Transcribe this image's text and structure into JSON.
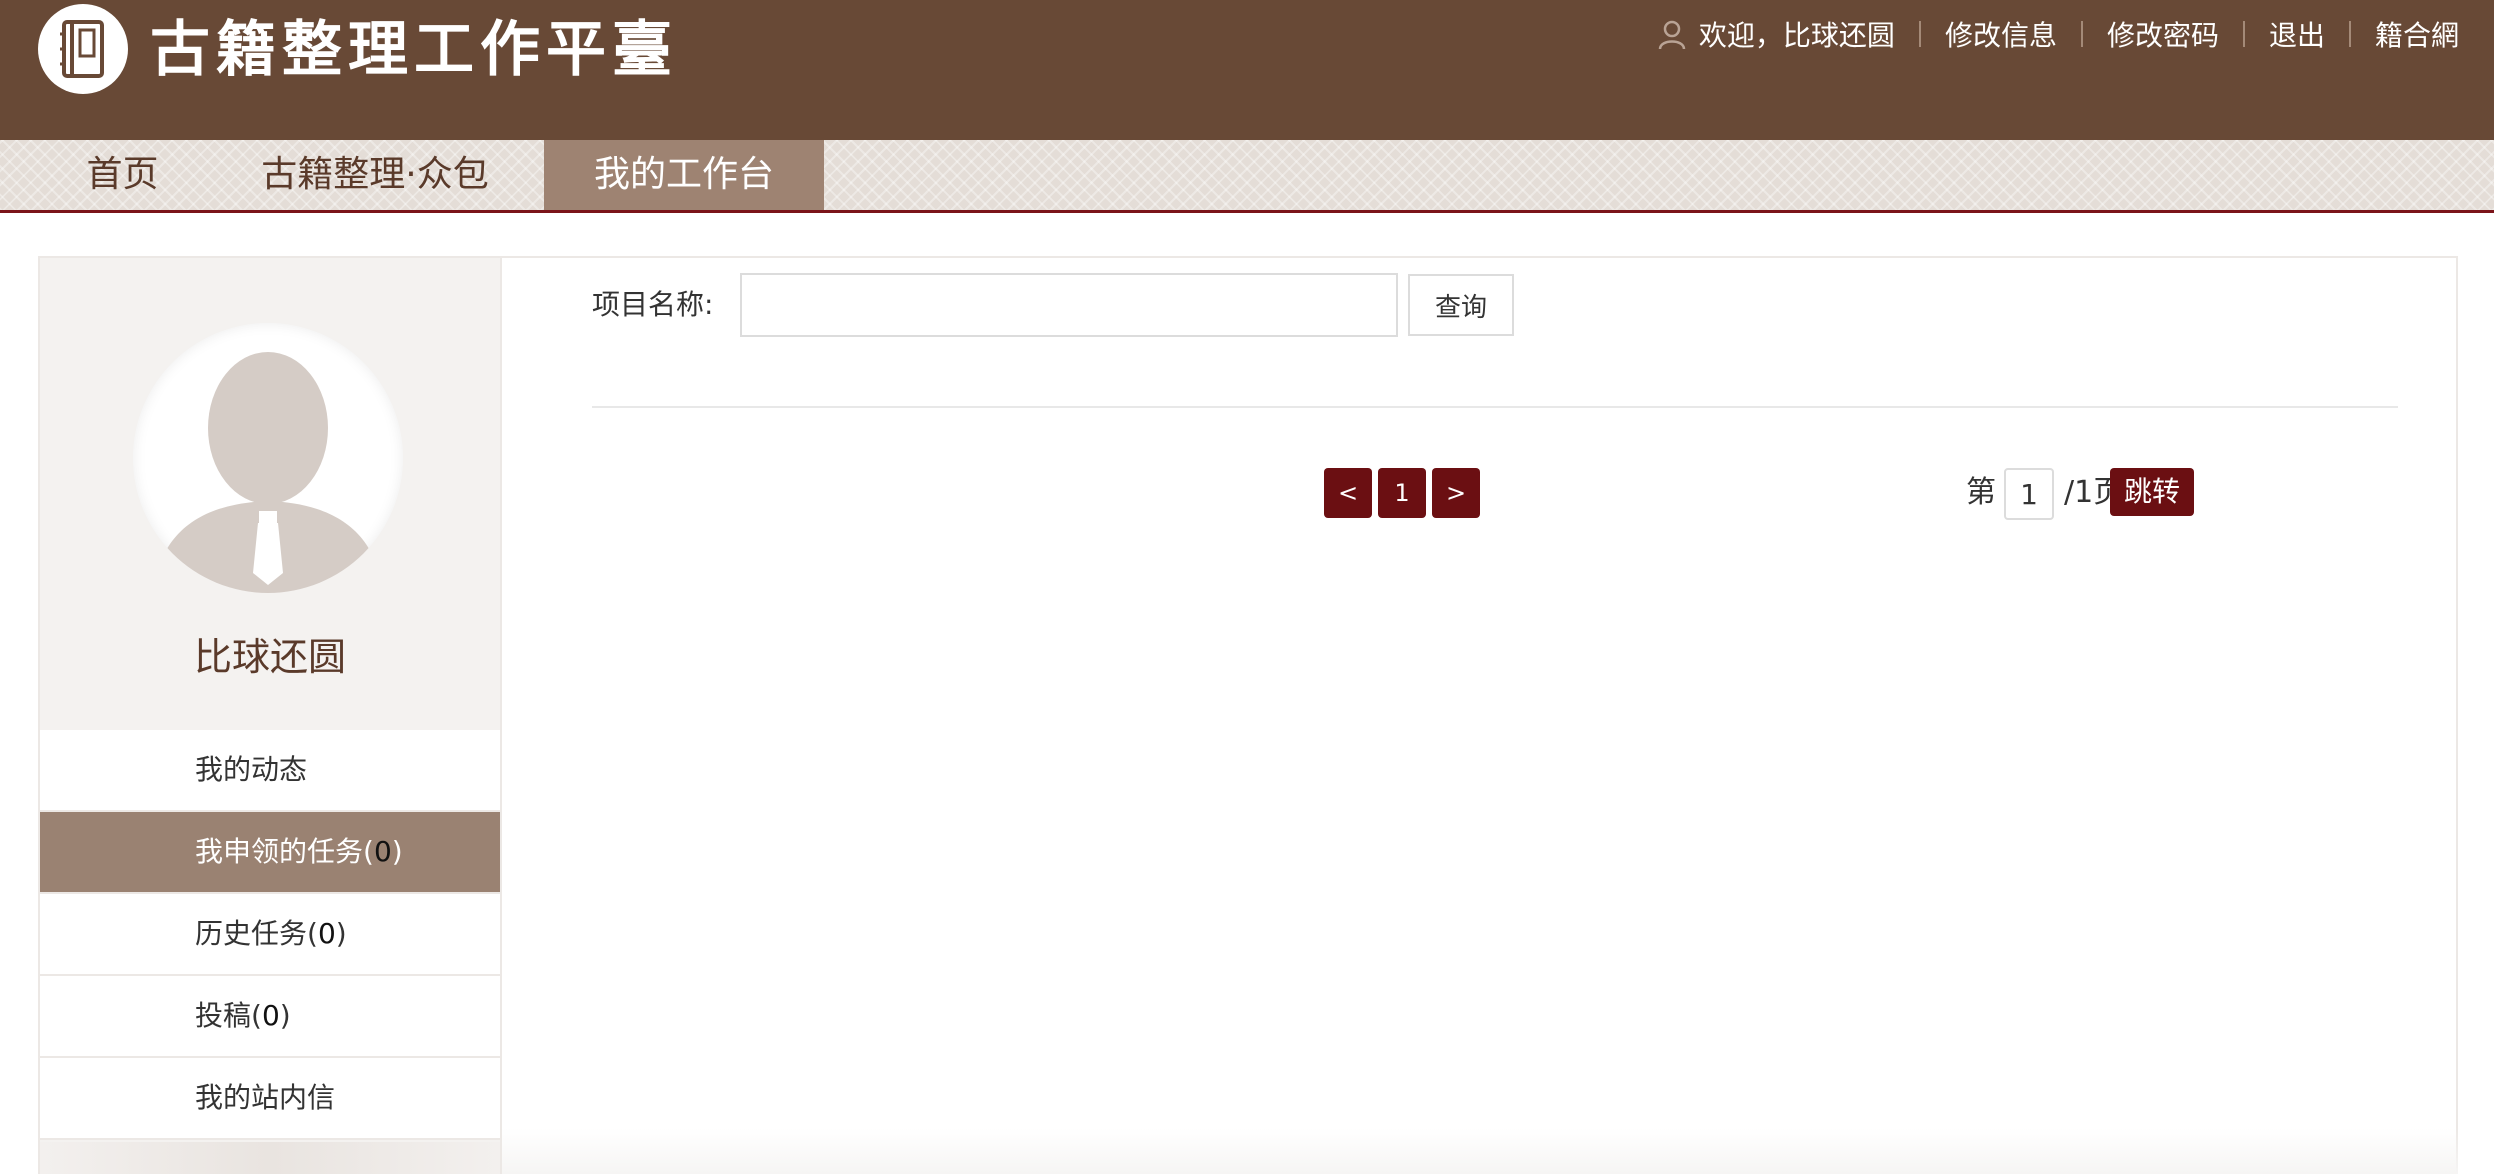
{
  "header": {
    "site_title": "古籍整理工作平臺",
    "logo_icon": "book-icon",
    "user_icon": "user-icon",
    "welcome": "欢迎，比球还圆",
    "links": [
      "修改信息",
      "修改密码",
      "退出",
      "籍合網"
    ]
  },
  "nav": {
    "items": [
      "首页",
      "古籍整理·众包",
      "我的工作台"
    ],
    "active": "我的工作台"
  },
  "sidebar": {
    "avatar_icon": "avatar-silhouette-icon",
    "user_name": "比球还圆",
    "menu": [
      {
        "label": "我的动态",
        "count": ""
      },
      {
        "label": "我申领的任务",
        "count": "0"
      },
      {
        "label": "历史任务",
        "count": "0"
      },
      {
        "label": "投稿",
        "count": "0"
      },
      {
        "label": "我的站内信",
        "count": ""
      }
    ],
    "active_item": "我申领的任务"
  },
  "search": {
    "label": "项目名称:",
    "value": "",
    "button": "查询"
  },
  "pagination": {
    "prev": "<",
    "current": "1",
    "next": ">",
    "prefix": "第",
    "page_input": "1",
    "suffix": "/1页",
    "go": "跳转"
  },
  "colors": {
    "header_bg": "#684936",
    "nav_active_bg": "#9e8372",
    "accent_dark_red": "#6b0f12",
    "sidebar_active_bg": "#9a8272"
  }
}
